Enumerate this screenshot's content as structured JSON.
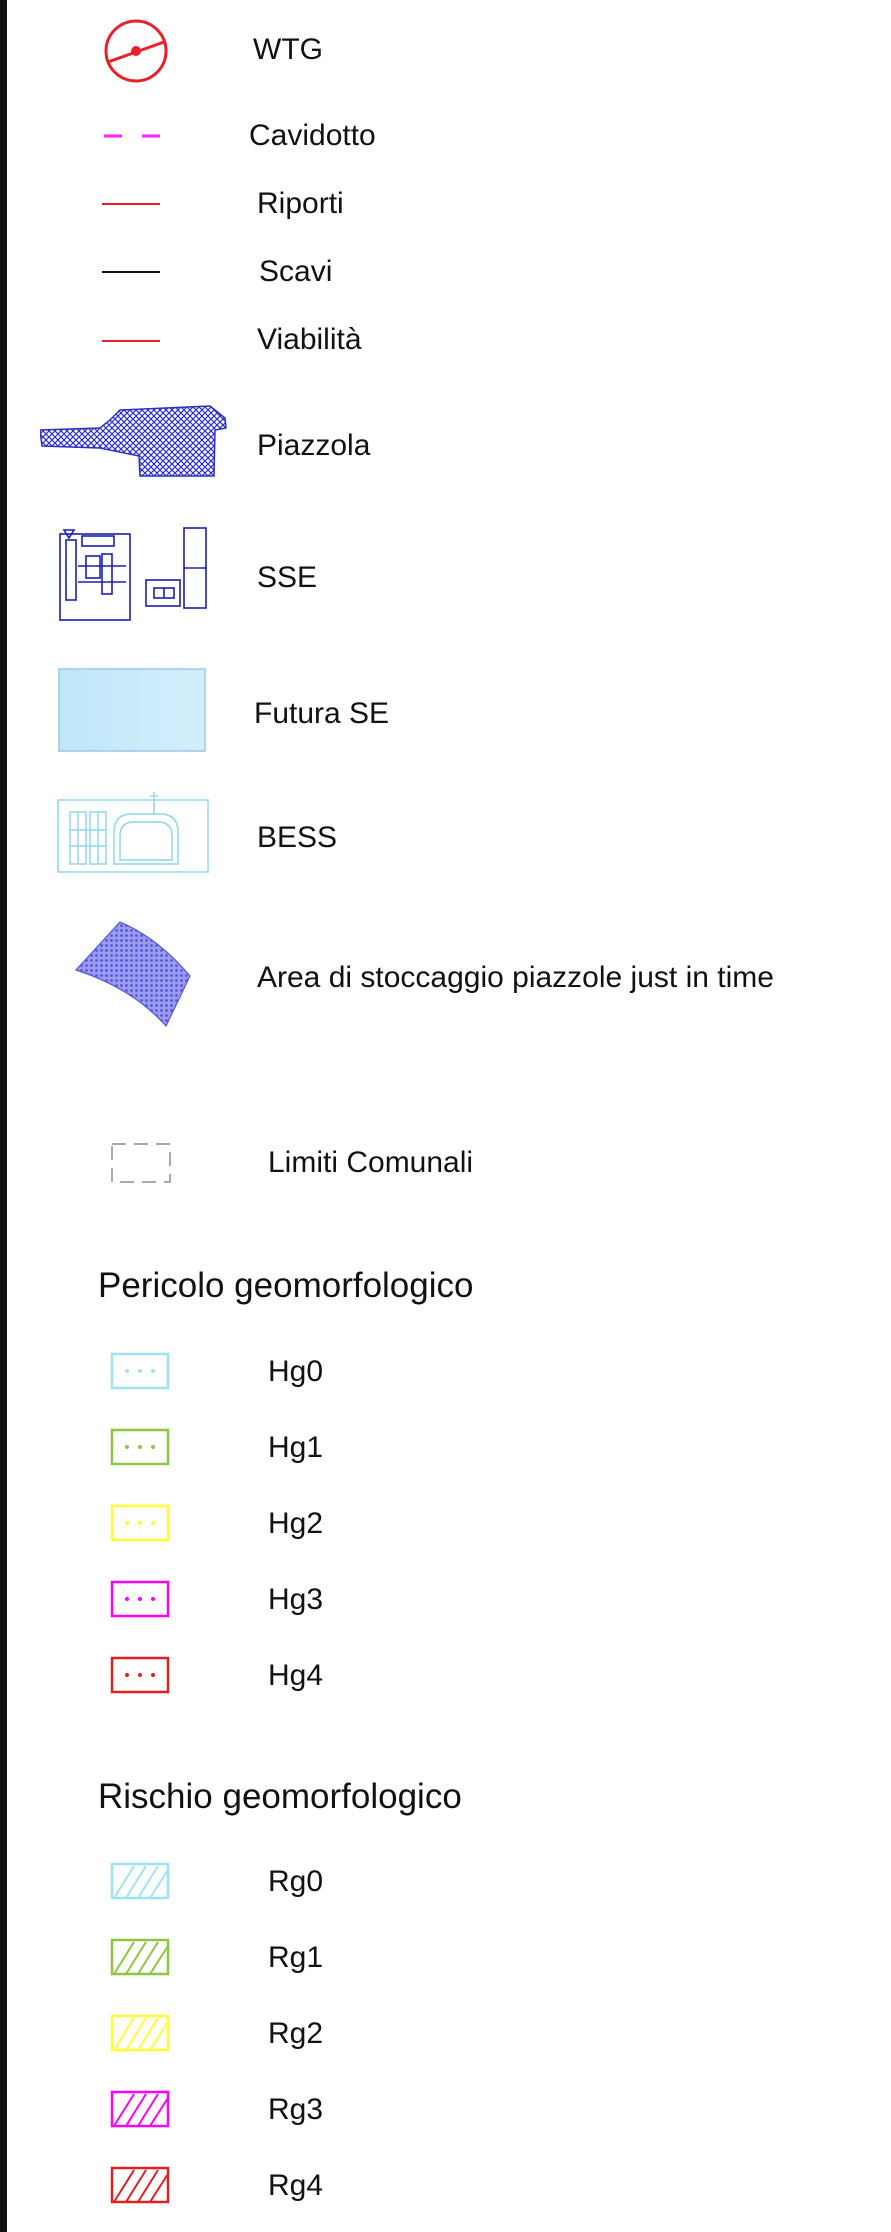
{
  "legend": {
    "items": [
      {
        "label": "WTG",
        "icon": "wind-turbine-icon",
        "color": "#e8202a"
      },
      {
        "label": "Cavidotto",
        "icon": "dashed-line-icon",
        "color": "#ff22ff"
      },
      {
        "label": "Riporti",
        "icon": "solid-line-icon",
        "color": "#e8202a"
      },
      {
        "label": "Scavi",
        "icon": "solid-line-icon",
        "color": "#111111"
      },
      {
        "label": "Viabilità",
        "icon": "solid-line-icon",
        "color": "#e8202a"
      },
      {
        "label": "Piazzola",
        "icon": "crosshatch-pad-icon",
        "color": "#2a2fc8"
      },
      {
        "label": "SSE",
        "icon": "substation-plan-icon",
        "color": "#1a1fb0"
      },
      {
        "label": "Futura SE",
        "icon": "light-blue-rect-icon",
        "color": "#bfe6fa"
      },
      {
        "label": "BESS",
        "icon": "battery-storage-plan-icon",
        "color": "#8fd3ee"
      },
      {
        "label": "Area di stoccaggio piazzole just in time",
        "icon": "storage-area-icon",
        "color": "#6c6ee0"
      },
      {
        "label": "Limiti Comunali",
        "icon": "dashed-rect-icon",
        "color": "#aaaaaa"
      }
    ],
    "pericolo": {
      "title": "Pericolo geomorfologico",
      "items": [
        {
          "label": "Hg0",
          "color": "#9fe3f2"
        },
        {
          "label": "Hg1",
          "color": "#8dc63f"
        },
        {
          "label": "Hg2",
          "color": "#ffff33"
        },
        {
          "label": "Hg3",
          "color": "#ff00ff"
        },
        {
          "label": "Hg4",
          "color": "#e02020"
        }
      ]
    },
    "rischio": {
      "title": "Rischio geomorfologico",
      "items": [
        {
          "label": "Rg0",
          "color": "#9fe3f2"
        },
        {
          "label": "Rg1",
          "color": "#8dc63f"
        },
        {
          "label": "Rg2",
          "color": "#ffff33"
        },
        {
          "label": "Rg3",
          "color": "#ff00ff"
        },
        {
          "label": "Rg4",
          "color": "#e02020"
        }
      ]
    }
  }
}
